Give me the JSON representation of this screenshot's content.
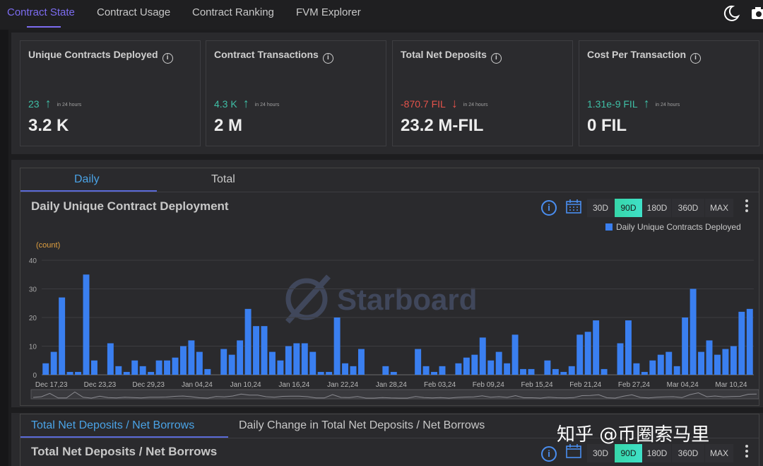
{
  "nav": {
    "tabs": [
      "Contract State",
      "Contract Usage",
      "Contract Ranking",
      "FVM Explorer"
    ]
  },
  "cards": [
    {
      "title": "Unique Contracts Deployed",
      "delta": "23",
      "direction": "up",
      "period": "in 24 hours",
      "value": "3.2 K"
    },
    {
      "title": "Contract Transactions",
      "delta": "4.3 K",
      "direction": "up",
      "period": "in 24 hours",
      "value": "2 M"
    },
    {
      "title": "Total Net Deposits",
      "delta": "-870.7 FIL",
      "direction": "down",
      "period": "in 24 hours",
      "value": "23.2 M-FIL"
    },
    {
      "title": "Cost Per Transaction",
      "delta": "1.31e-9 FIL",
      "direction": "up",
      "period": "in 24 hours",
      "value": "0 FIL"
    }
  ],
  "chart_section": {
    "tabs": [
      "Daily",
      "Total"
    ],
    "title": "Daily Unique Contract Deployment",
    "ranges": [
      "30D",
      "90D",
      "180D",
      "360D",
      "MAX"
    ],
    "active_range": "90D",
    "watermark": "Starboard"
  },
  "bottom_section": {
    "tabs": [
      "Total Net Deposits / Net Borrows",
      "Daily Change in Total Net Deposits / Net Borrows"
    ],
    "title": "Total Net Deposits / Net Borrows",
    "ranges": [
      "30D",
      "90D",
      "180D",
      "360D",
      "MAX"
    ],
    "active_range": "90D"
  },
  "overlay_watermark": "知乎 @币圈索马里",
  "colors": {
    "accent": "#7c6cf0",
    "bar": "#3a7ff0",
    "positive": "#3fbfa6",
    "negative": "#e5534b",
    "active_range": "#36d6a8"
  },
  "chart_data": {
    "type": "bar",
    "ylabel": "(count)",
    "ylim": [
      0,
      40
    ],
    "yticks": [
      0,
      10,
      20,
      30,
      40
    ],
    "grid": true,
    "legend_position": "top-right",
    "x_tick_labels": [
      "Dec 17,23",
      "Dec 23,23",
      "Dec 29,23",
      "Jan 04,24",
      "Jan 10,24",
      "Jan 16,24",
      "Jan 22,24",
      "Jan 28,24",
      "Feb 03,24",
      "Feb 09,24",
      "Feb 15,24",
      "Feb 21,24",
      "Feb 27,24",
      "Mar 04,24",
      "Mar 10,24"
    ],
    "series": [
      {
        "name": "Daily Unique Contracts Deployed",
        "values": [
          4,
          8,
          27,
          1,
          1,
          35,
          5,
          0,
          11,
          3,
          1,
          5,
          3,
          1,
          5,
          5,
          6,
          10,
          12,
          8,
          2,
          0,
          9,
          7,
          12,
          23,
          17,
          17,
          8,
          5,
          10,
          11,
          11,
          8,
          1,
          1,
          20,
          4,
          3,
          9,
          0,
          0,
          3,
          1,
          0,
          0,
          9,
          3,
          1,
          3,
          0,
          4,
          6,
          7,
          13,
          5,
          8,
          4,
          14,
          2,
          2,
          0,
          5,
          2,
          1,
          3,
          14,
          15,
          19,
          2,
          0,
          11,
          19,
          4,
          1,
          5,
          7,
          8,
          3,
          20,
          30,
          8,
          12,
          7,
          9,
          10,
          22,
          23
        ]
      }
    ]
  }
}
